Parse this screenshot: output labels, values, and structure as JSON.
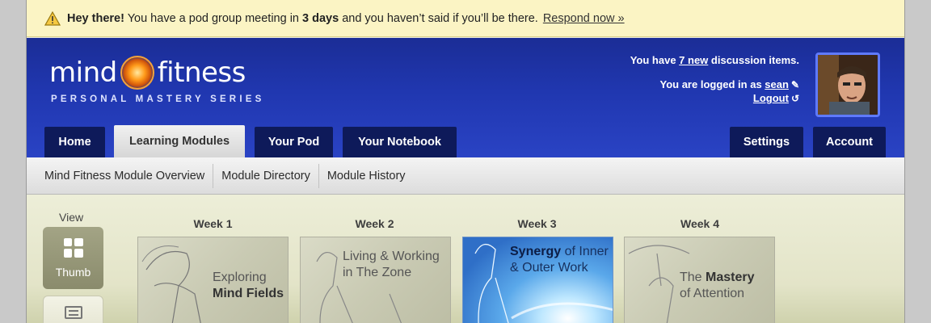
{
  "notice": {
    "greeting": "Hey there!",
    "message_pre": " You have a pod group meeting in ",
    "message_bold": "3 days",
    "message_post": " and you haven’t said if you’ll be there.",
    "link": "Respond now »"
  },
  "brand": {
    "word1": "mind",
    "word2": "fitness",
    "tagline": "PERSONAL MASTERY SERIES"
  },
  "user": {
    "discussion_pre": "You have ",
    "discussion_link": "7 new",
    "discussion_post": " discussion items.",
    "logged_pre": "You are logged in as ",
    "username": "sean",
    "logout": "Logout"
  },
  "tabs": [
    "Home",
    "Learning Modules",
    "Your Pod",
    "Your Notebook",
    "Settings",
    "Account"
  ],
  "subnav": [
    "Mind Fitness Module Overview",
    "Module Directory",
    "Module History"
  ],
  "view": {
    "label": "View",
    "thumb": "Thumb"
  },
  "modules": [
    {
      "week": "Week 1",
      "line1a": "Exploring",
      "line2b": "Mind Fields"
    },
    {
      "week": "Week 2",
      "line1a": "Living & Working",
      "line2a": "in The Zone"
    },
    {
      "week": "Week 3",
      "line1b": "Synergy",
      "line1a": " of Inner",
      "line2a": "& Outer Work"
    },
    {
      "week": "Week 4",
      "line1a": "The ",
      "line1b": "Mastery",
      "line2a": "of Attention"
    }
  ],
  "colors": {
    "header_blue": "#2037b0",
    "tab_navy": "#0e1a5a",
    "notice_bg": "#fbf4c4"
  }
}
